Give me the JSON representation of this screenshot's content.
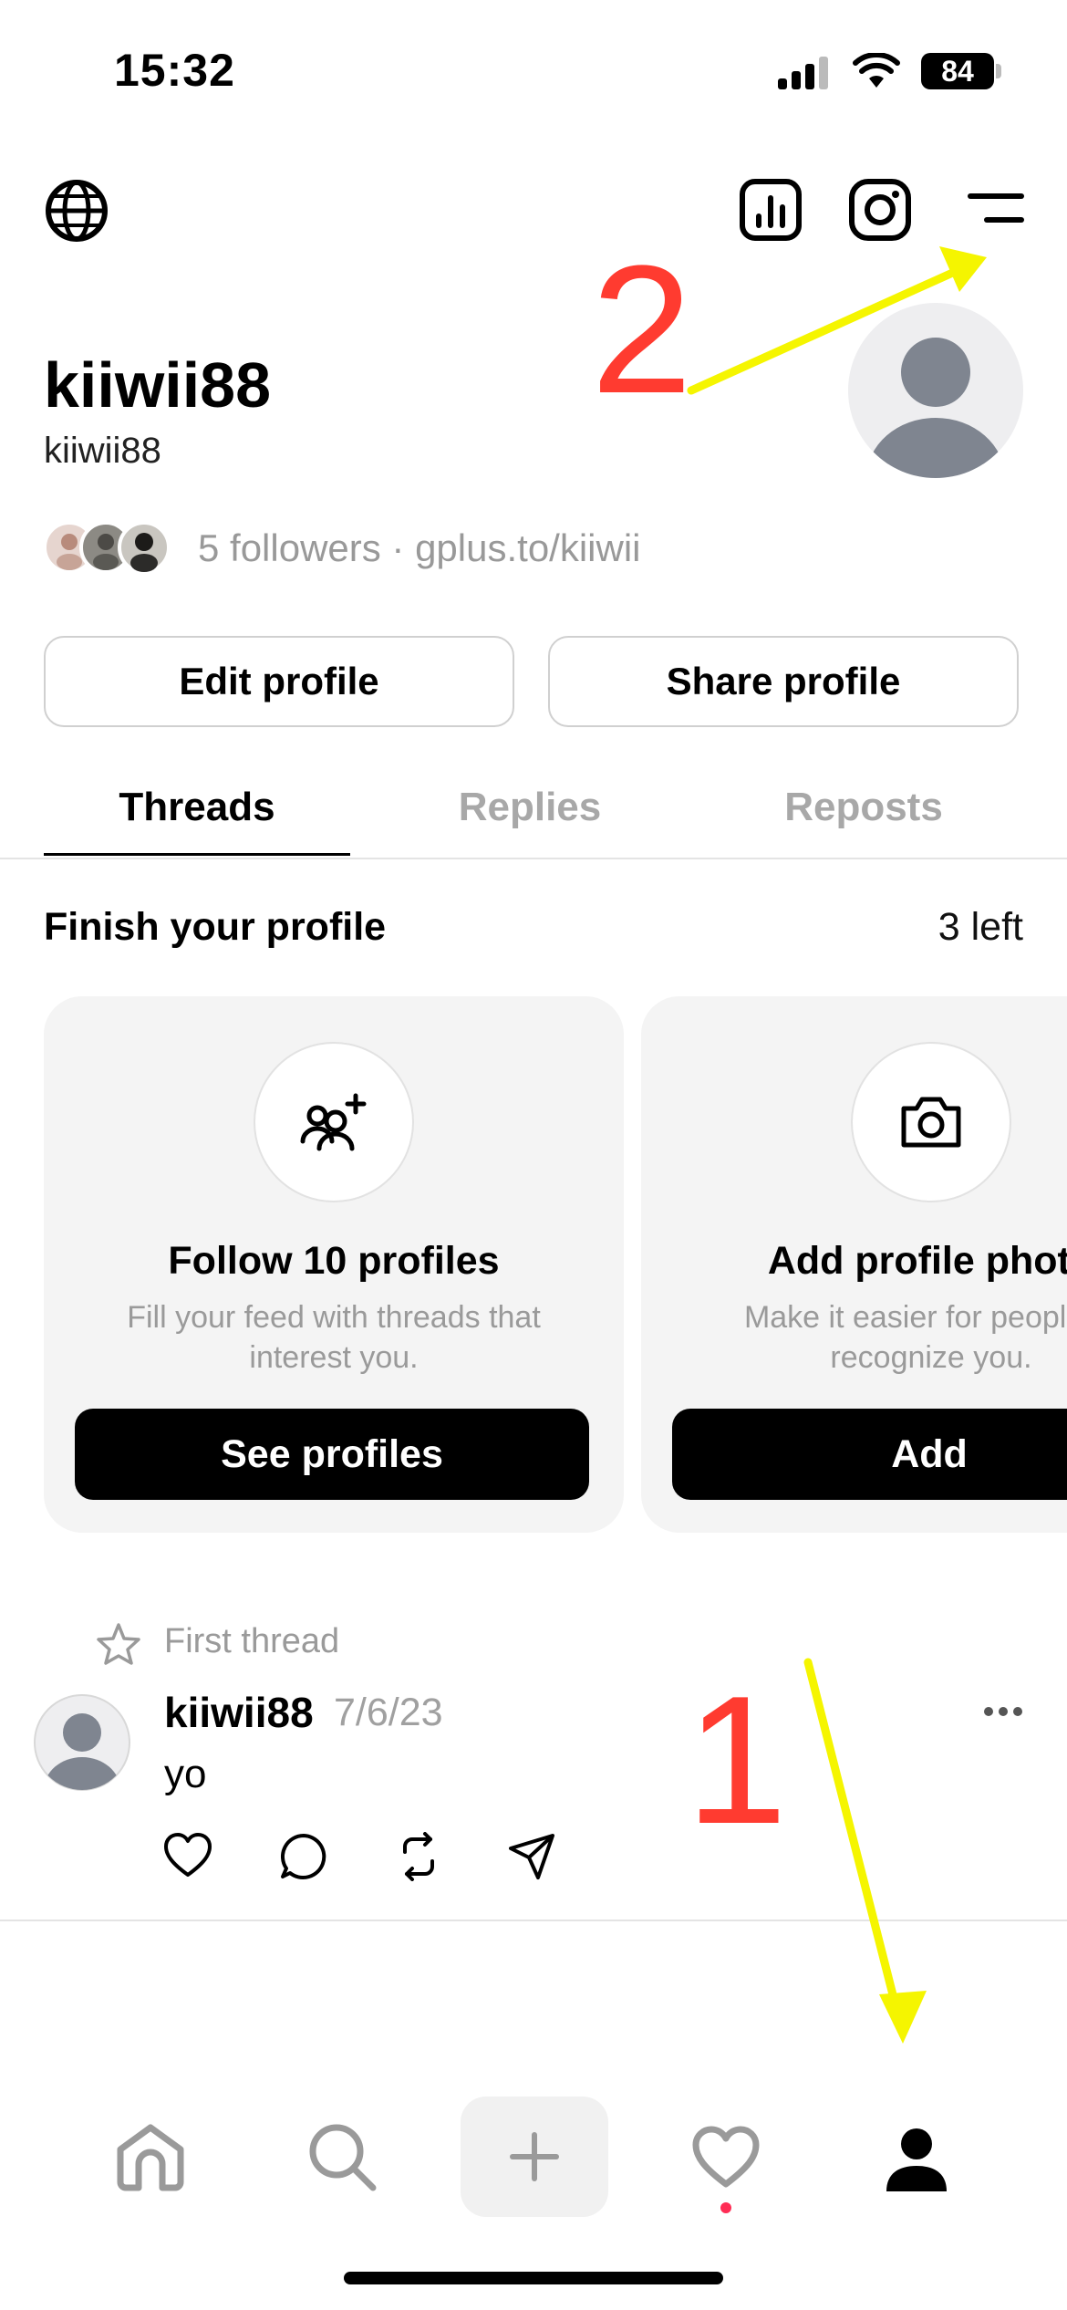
{
  "status_bar": {
    "time": "15:32",
    "battery": "84"
  },
  "profile": {
    "name": "kiiwii88",
    "handle": "kiiwii88",
    "followers_text": "5 followers · gplus.to/kiiwii"
  },
  "buttons": {
    "edit_profile": "Edit profile",
    "share_profile": "Share profile"
  },
  "tabs": [
    {
      "label": "Threads",
      "active": true
    },
    {
      "label": "Replies",
      "active": false
    },
    {
      "label": "Reposts",
      "active": false
    }
  ],
  "finish_profile": {
    "title": "Finish your profile",
    "remaining": "3 left",
    "cards": [
      {
        "icon": "add-people-icon",
        "title": "Follow 10 profiles",
        "description": "Fill your feed with threads that interest you.",
        "button": "See profiles"
      },
      {
        "icon": "camera-icon",
        "title": "Add profile photo",
        "description": "Make it easier for people to recognize you.",
        "button": "Add"
      }
    ]
  },
  "post": {
    "pinned_label": "First thread",
    "username": "kiiwii88",
    "date": "7/6/23",
    "text": "yo"
  },
  "annotations": {
    "one": "1",
    "two": "2"
  },
  "colors": {
    "annotation_number": "#ff3b30",
    "annotation_arrow": "#f5f500",
    "notification_dot": "#ff2d55"
  }
}
